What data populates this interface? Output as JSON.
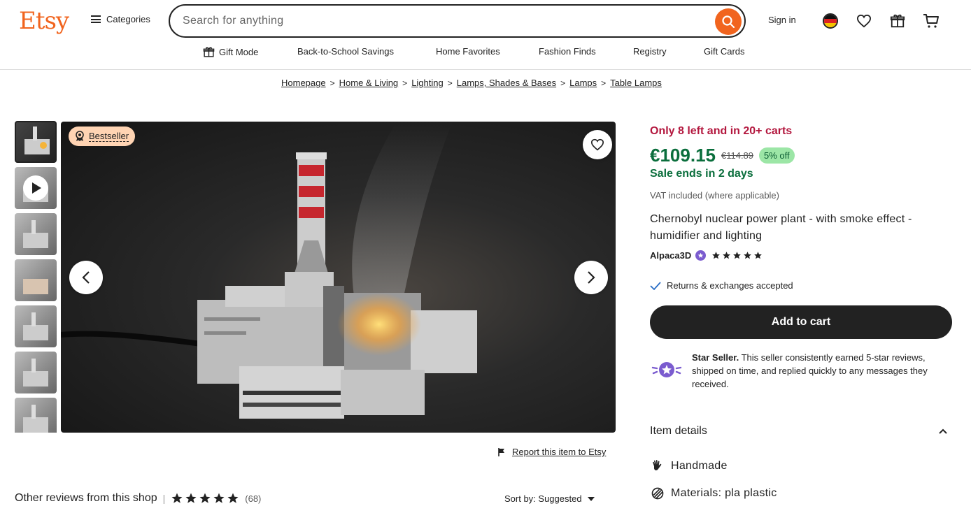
{
  "header": {
    "logo": "Etsy",
    "categories_label": "Categories",
    "search_placeholder": "Search for anything",
    "signin_label": "Sign in"
  },
  "subnav": [
    {
      "label": "Gift Mode",
      "icon": "gift-icon"
    },
    {
      "label": "Back-to-School Savings"
    },
    {
      "label": "Home Favorites"
    },
    {
      "label": "Fashion Finds"
    },
    {
      "label": "Registry"
    },
    {
      "label": "Gift Cards"
    }
  ],
  "breadcrumb": [
    "Homepage",
    "Home & Living",
    "Lighting",
    "Lamps, Shades & Bases",
    "Lamps",
    "Table Lamps"
  ],
  "gallery": {
    "badge": "Bestseller",
    "thumb_count": 7,
    "report_label": "Report this item to Etsy"
  },
  "reviews": {
    "heading": "Other reviews from this shop",
    "rating": 5,
    "count_label": "(68)",
    "sort_label": "Sort by: Suggested"
  },
  "product": {
    "stock_label": "Only 8 left and in 20+ carts",
    "price": "€109.15",
    "old_price": "€114.89",
    "discount": "5% off",
    "sale_label": "Sale ends in 2 days",
    "vat_label": "VAT included (where applicable)",
    "title": "Chernobyl nuclear power plant - with smoke effect - humidifier and lighting",
    "shop_name": "Alpaca3D",
    "shop_rating": 5,
    "returns_label": "Returns & exchanges accepted",
    "add_to_cart": "Add to cart",
    "star_seller_title": "Star Seller.",
    "star_seller_text": "This seller consistently earned 5-star reviews, shipped on time, and replied quickly to any messages they received.",
    "item_details_heading": "Item details",
    "details": [
      {
        "label": "Handmade",
        "icon": "hand-wave-icon"
      },
      {
        "label": "Materials: pla plastic",
        "icon": "materials-icon"
      }
    ]
  },
  "colors": {
    "brand": "#f1641e",
    "sale_green": "#0a6e3c",
    "stock_red": "#b3173e",
    "discount_bg": "#9ce6a6",
    "badge_bg": "#ffd4b3",
    "star_seller_purple": "#7b5ccf"
  }
}
